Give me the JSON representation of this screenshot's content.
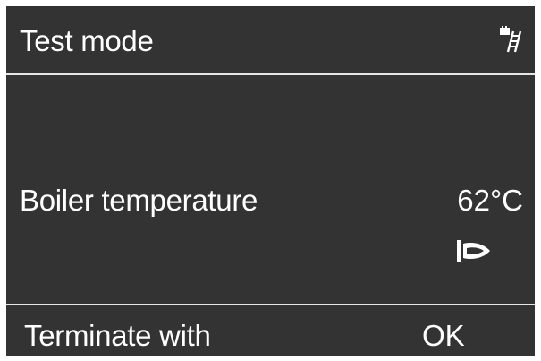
{
  "header": {
    "title": "Test mode",
    "icon": "chimney-sweep-icon"
  },
  "main": {
    "label": "Boiler temperature",
    "value": "62°C",
    "status_icon": "burner-flame-icon"
  },
  "footer": {
    "label": "Terminate with",
    "key": "OK"
  },
  "colors": {
    "background": "#333333",
    "text": "#ffffff",
    "divider": "#e6e6e6"
  }
}
